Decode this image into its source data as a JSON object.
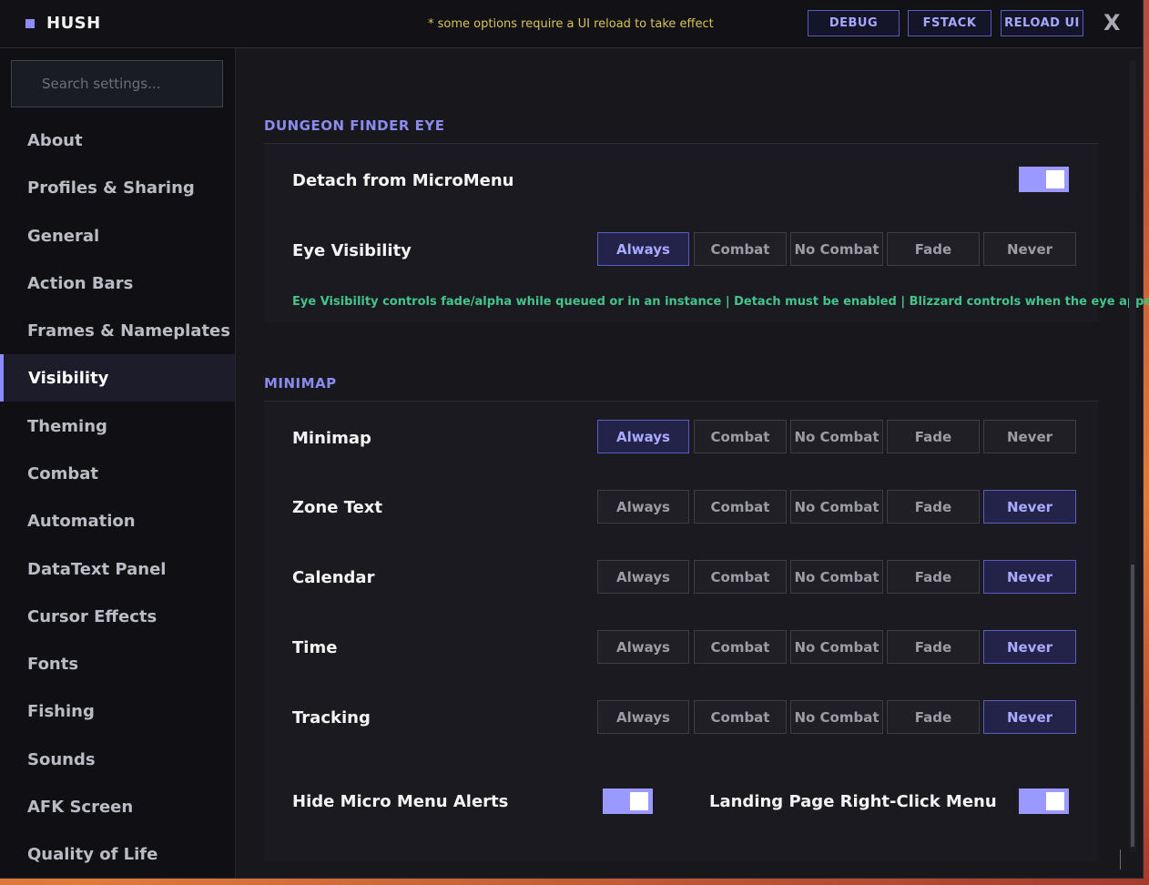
{
  "app": {
    "title": "HUSH",
    "notice": "* some options require a UI reload to take effect",
    "buttons": {
      "debug": "DEBUG",
      "fstack": "FSTACK",
      "reload": "RELOAD UI"
    },
    "close": "X"
  },
  "sidebar": {
    "search_placeholder": "Search settings...",
    "items": [
      {
        "label": "About"
      },
      {
        "label": "Profiles & Sharing"
      },
      {
        "label": "General"
      },
      {
        "label": "Action Bars"
      },
      {
        "label": "Frames & Nameplates"
      },
      {
        "label": "Visibility",
        "active": true
      },
      {
        "label": "Theming"
      },
      {
        "label": "Combat"
      },
      {
        "label": "Automation"
      },
      {
        "label": "DataText Panel"
      },
      {
        "label": "Cursor Effects"
      },
      {
        "label": "Fonts"
      },
      {
        "label": "Fishing"
      },
      {
        "label": "Sounds"
      },
      {
        "label": "AFK Screen"
      },
      {
        "label": "Quality of Life"
      }
    ]
  },
  "options": [
    "Always",
    "Combat",
    "No Combat",
    "Fade",
    "Never"
  ],
  "sections": {
    "dungeon": {
      "title": "DUNGEON FINDER EYE",
      "detach_label": "Detach from MicroMenu",
      "detach_on": true,
      "eye_label": "Eye Visibility",
      "eye_selected": "Always",
      "hint": "Eye Visibility controls fade/alpha while queued or in an instance  |  Detach must be enabled  |  Blizzard controls when the eye appears"
    },
    "minimap": {
      "title": "MINIMAP",
      "rows": [
        {
          "label": "Minimap",
          "selected": "Always"
        },
        {
          "label": "Zone Text",
          "selected": "Never"
        },
        {
          "label": "Calendar",
          "selected": "Never"
        },
        {
          "label": "Time",
          "selected": "Never"
        },
        {
          "label": "Tracking",
          "selected": "Never"
        }
      ],
      "hide_alerts_label": "Hide Micro Menu Alerts",
      "hide_alerts_on": true,
      "landing_label": "Landing Page Right-Click Menu",
      "landing_on": true
    }
  },
  "colors": {
    "accent": "#8a8aff",
    "selected_bg": "#23234a",
    "hint_green": "#44c48a",
    "notice_yellow": "#d8c35a"
  },
  "icons": {
    "logo": "square-icon",
    "close": "close-icon",
    "grip": "resize-grip-icon"
  }
}
